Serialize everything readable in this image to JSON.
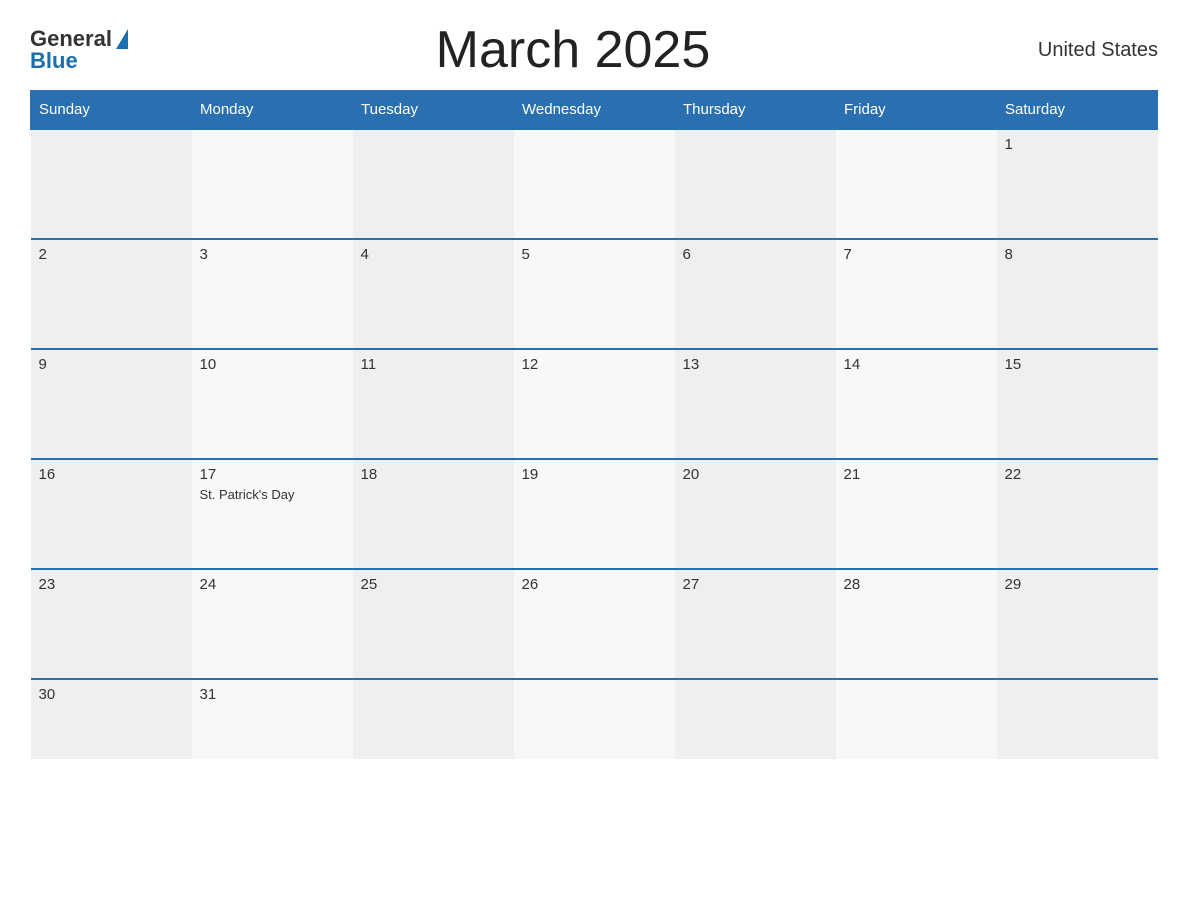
{
  "header": {
    "logo_general": "General",
    "logo_blue": "Blue",
    "title": "March 2025",
    "country": "United States"
  },
  "calendar": {
    "days_of_week": [
      "Sunday",
      "Monday",
      "Tuesday",
      "Wednesday",
      "Thursday",
      "Friday",
      "Saturday"
    ],
    "weeks": [
      [
        {
          "day": "",
          "event": ""
        },
        {
          "day": "",
          "event": ""
        },
        {
          "day": "",
          "event": ""
        },
        {
          "day": "",
          "event": ""
        },
        {
          "day": "",
          "event": ""
        },
        {
          "day": "",
          "event": ""
        },
        {
          "day": "1",
          "event": ""
        }
      ],
      [
        {
          "day": "2",
          "event": ""
        },
        {
          "day": "3",
          "event": ""
        },
        {
          "day": "4",
          "event": ""
        },
        {
          "day": "5",
          "event": ""
        },
        {
          "day": "6",
          "event": ""
        },
        {
          "day": "7",
          "event": ""
        },
        {
          "day": "8",
          "event": ""
        }
      ],
      [
        {
          "day": "9",
          "event": ""
        },
        {
          "day": "10",
          "event": ""
        },
        {
          "day": "11",
          "event": ""
        },
        {
          "day": "12",
          "event": ""
        },
        {
          "day": "13",
          "event": ""
        },
        {
          "day": "14",
          "event": ""
        },
        {
          "day": "15",
          "event": ""
        }
      ],
      [
        {
          "day": "16",
          "event": ""
        },
        {
          "day": "17",
          "event": "St. Patrick's Day"
        },
        {
          "day": "18",
          "event": ""
        },
        {
          "day": "19",
          "event": ""
        },
        {
          "day": "20",
          "event": ""
        },
        {
          "day": "21",
          "event": ""
        },
        {
          "day": "22",
          "event": ""
        }
      ],
      [
        {
          "day": "23",
          "event": ""
        },
        {
          "day": "24",
          "event": ""
        },
        {
          "day": "25",
          "event": ""
        },
        {
          "day": "26",
          "event": ""
        },
        {
          "day": "27",
          "event": ""
        },
        {
          "day": "28",
          "event": ""
        },
        {
          "day": "29",
          "event": ""
        }
      ],
      [
        {
          "day": "30",
          "event": ""
        },
        {
          "day": "31",
          "event": ""
        },
        {
          "day": "",
          "event": ""
        },
        {
          "day": "",
          "event": ""
        },
        {
          "day": "",
          "event": ""
        },
        {
          "day": "",
          "event": ""
        },
        {
          "day": "",
          "event": ""
        }
      ]
    ]
  }
}
